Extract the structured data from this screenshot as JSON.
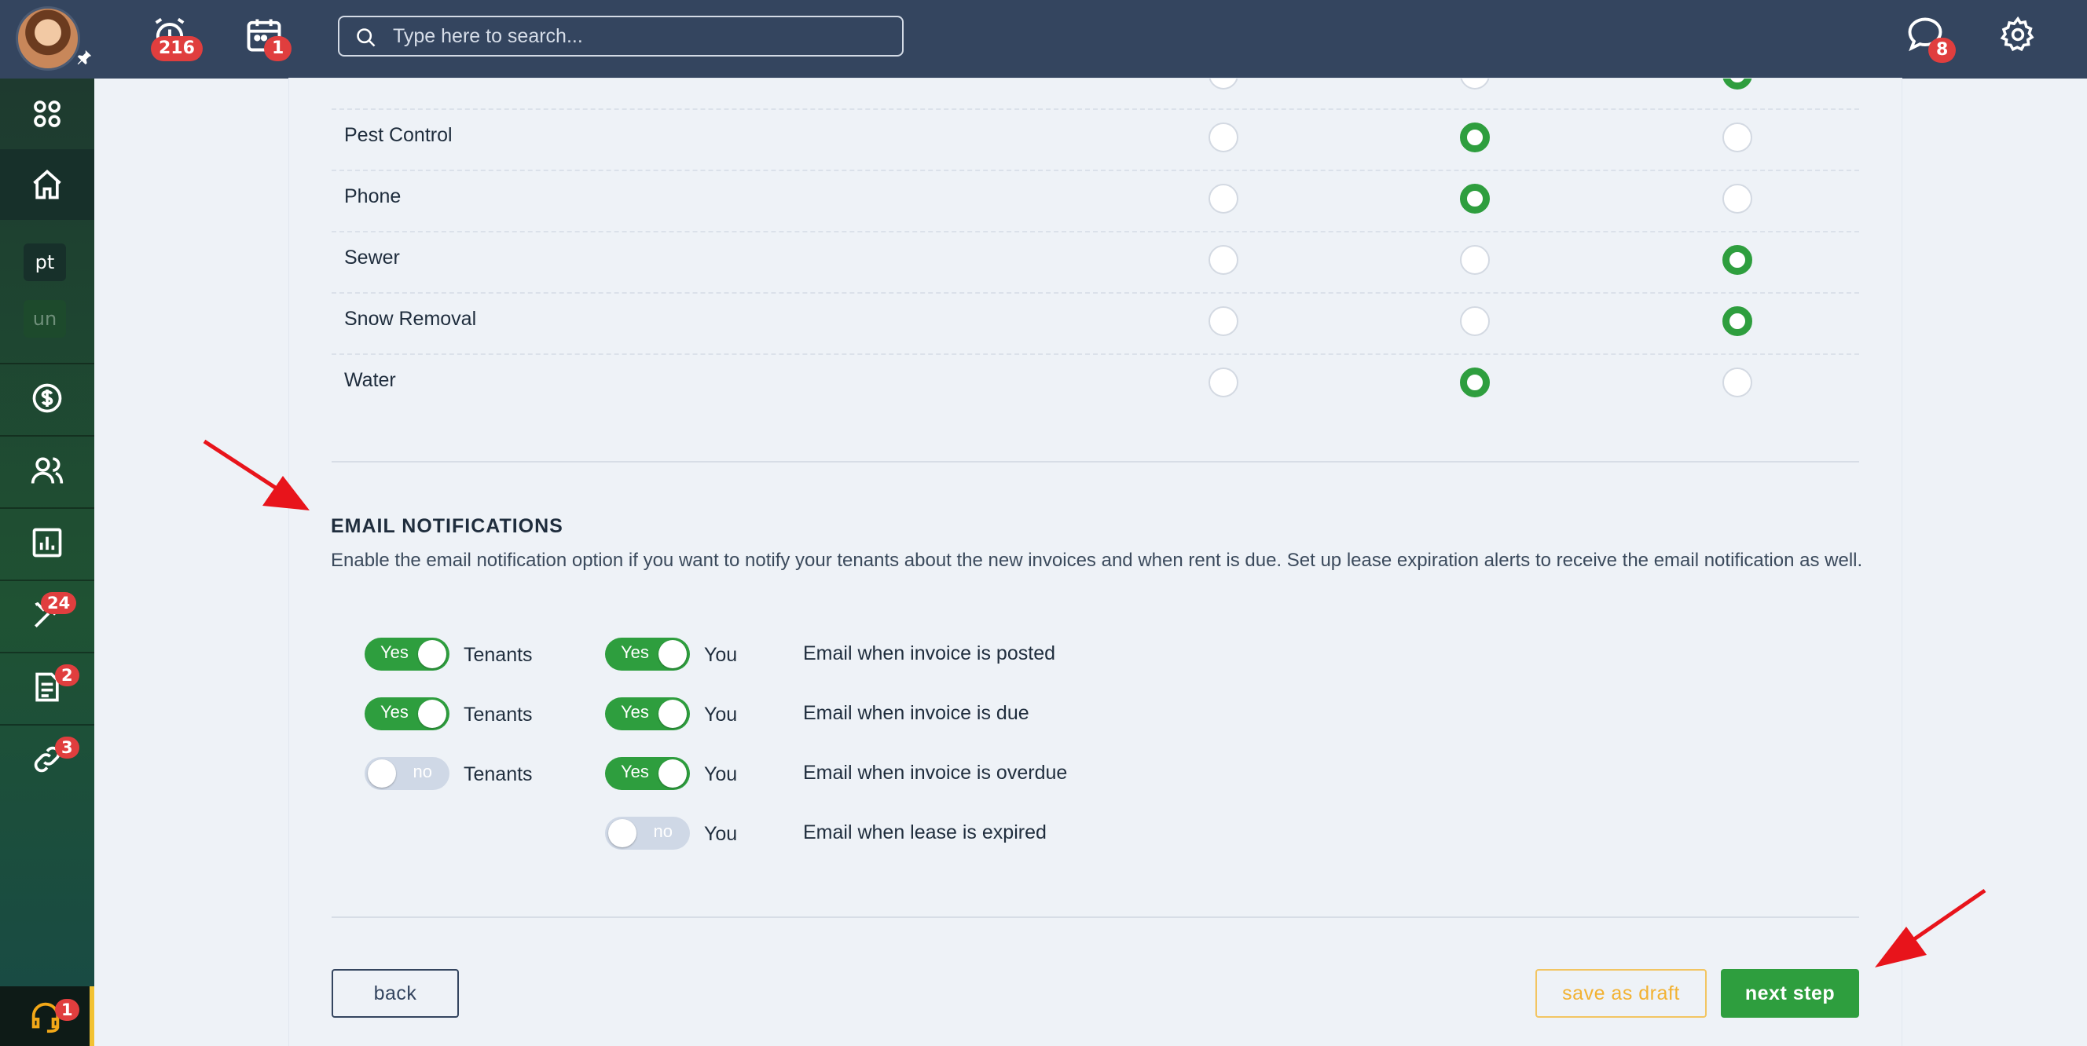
{
  "topbar": {
    "alarm_count": "216",
    "calendar_count": "1",
    "search_placeholder": "Type here to search...",
    "chat_count": "8"
  },
  "sidebar": {
    "tag_pt": "pt",
    "tag_un": "un",
    "maintenance_count": "24",
    "documents_count": "2",
    "links_count": "3",
    "support_count": "1"
  },
  "utilities": {
    "rows": [
      {
        "label": "Pest Control",
        "selected": 1
      },
      {
        "label": "Phone",
        "selected": 1
      },
      {
        "label": "Sewer",
        "selected": 2
      },
      {
        "label": "Snow Removal",
        "selected": 2
      },
      {
        "label": "Water",
        "selected": 1
      }
    ]
  },
  "email_notifications": {
    "title": "EMAIL NOTIFICATIONS",
    "description": "Enable the email notification option if you want to notify your tenants about the new invoices and when rent is due. Set up lease expiration alerts to receive the email notification as well.",
    "tenants_label": "Tenants",
    "you_label": "You",
    "yes_label": "Yes",
    "no_label": "no",
    "items": [
      {
        "text": "Email when invoice is posted",
        "tenants": true,
        "you": true
      },
      {
        "text": "Email when invoice is due",
        "tenants": true,
        "you": true
      },
      {
        "text": "Email when invoice is overdue",
        "tenants": false,
        "you": true
      },
      {
        "text": "Email when lease is expired",
        "tenants": null,
        "you": false
      }
    ]
  },
  "footer": {
    "back_label": "back",
    "draft_label": "save as draft",
    "next_label": "next step"
  },
  "colors": {
    "topbar": "#34455f",
    "accent_green": "#2e9e3e",
    "badge_red": "#e03e3e",
    "draft_yellow": "#f2b233",
    "annotation_red": "#e8141b"
  }
}
